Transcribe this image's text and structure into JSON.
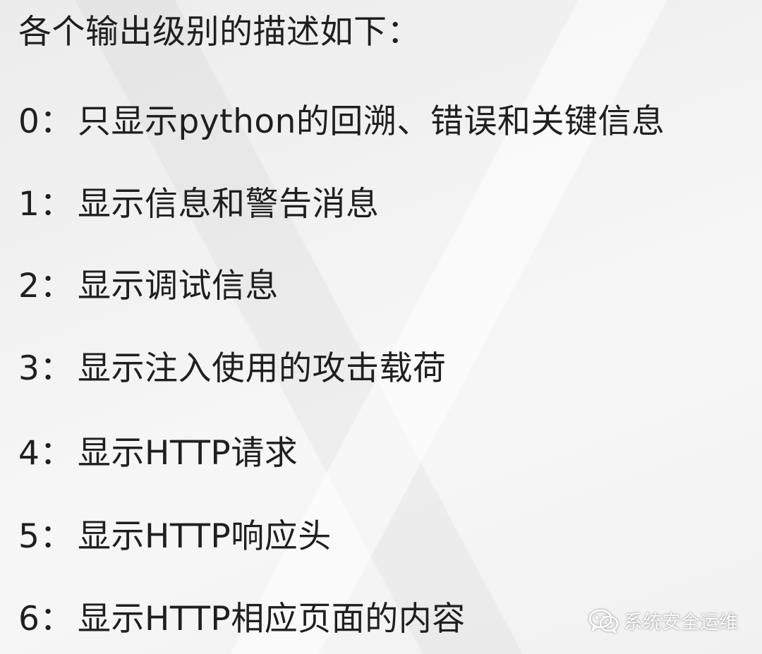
{
  "heading": "各个输出级别的描述如下：",
  "levels": [
    {
      "num": "0：",
      "text": "只显示python的回溯、错误和关键信息"
    },
    {
      "num": "1：",
      "text": "显示信息和警告消息"
    },
    {
      "num": "2：",
      "text": "显示调试信息"
    },
    {
      "num": "3：",
      "text": "显示注入使用的攻击载荷"
    },
    {
      "num": "4：",
      "text": "显示HTTP请求"
    },
    {
      "num": "5：",
      "text": "显示HTTP响应头"
    },
    {
      "num": "6：",
      "text": "显示HTTP相应页面的内容"
    }
  ],
  "watermark": {
    "icon": "wechat-icon",
    "text": "系统安全运维"
  }
}
